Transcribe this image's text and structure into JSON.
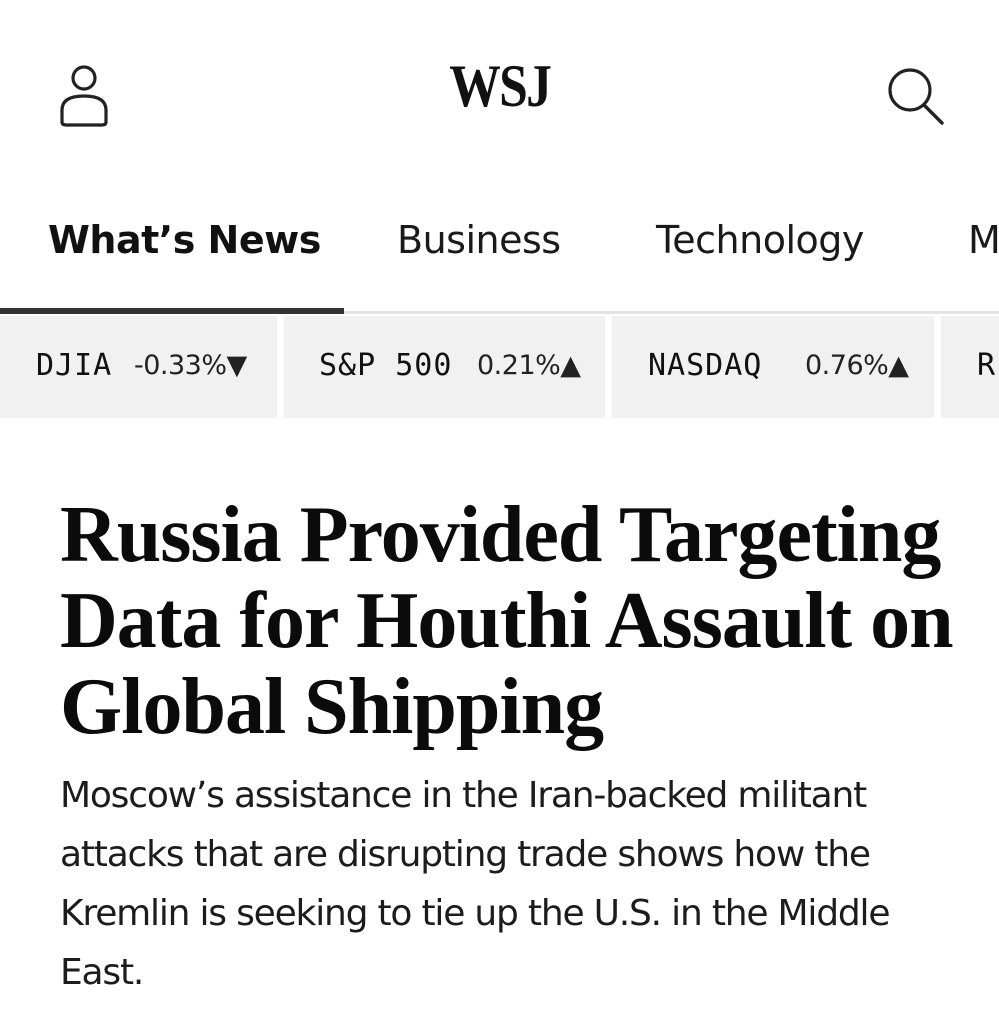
{
  "header": {
    "logo_text": "WSJ",
    "account_icon": "user-icon",
    "search_icon": "search-icon"
  },
  "nav": {
    "items": [
      {
        "label": "What’s News",
        "active": true
      },
      {
        "label": "Business",
        "active": false
      },
      {
        "label": "Technology",
        "active": false
      },
      {
        "label": "M",
        "active": false
      }
    ]
  },
  "ticker": {
    "items": [
      {
        "name": "DJIA",
        "change": "-0.33%",
        "direction": "down"
      },
      {
        "name": "S&P 500",
        "change": "0.21%",
        "direction": "up"
      },
      {
        "name": "NASDAQ",
        "change": "0.76%",
        "direction": "up"
      },
      {
        "name": "R",
        "change": "",
        "direction": ""
      }
    ],
    "down_glyph": "▼",
    "up_glyph": "▲"
  },
  "article": {
    "headline": "Russia Provided Targeting Data for Houthi Assault on Global Shipping",
    "dek": "Moscow’s assistance in the Iran-backed militant attacks that are disrupting trade shows how the Kremlin is seeking to tie up the U.S. in the Middle East."
  },
  "colors": {
    "text": "#111111",
    "ticker_bg": "#f1f1f1",
    "nav_underline": "#333333"
  }
}
